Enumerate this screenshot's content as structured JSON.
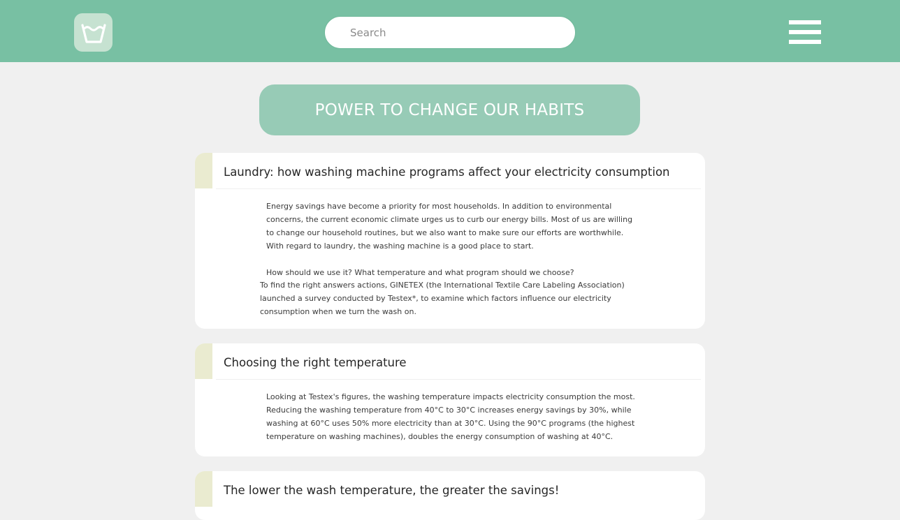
{
  "header": {
    "logo_icon": "wash-basin-icon",
    "search": {
      "placeholder": "Search",
      "value": ""
    },
    "menu_icon": "hamburger-menu-icon",
    "colors": {
      "header_bg": "#78c0a3",
      "banner_bg": "#97cbb6",
      "accent": "#eaebd0"
    }
  },
  "banner": {
    "title": "POWER TO CHANGE OUR HABITS"
  },
  "articles": [
    {
      "title": "Laundry: how washing machine programs affect your electricity consumption",
      "paragraphs": [
        "Energy savings have become a priority for most households. In addition to environmental concerns, the current economic climate urges us to curb our energy bills. Most of us are willing to change our household routines, but we also want to make sure our efforts are worthwhile. With regard to laundry, the washing machine is a good place to start.",
        "How should we use it? What temperature and what program should we choose?",
        "To find the right answers actions, GINETEX (the International Textile Care Labeling Association) launched a survey conducted by Testex*, to examine which factors influence our electricity consumption when we turn the wash on."
      ]
    },
    {
      "title": "Choosing the right temperature",
      "paragraphs": [
        "Looking at Testex's figures, the washing temperature impacts electricity consumption the most. Reducing the washing temperature from 40°C to 30°C increases energy savings by 30%, while washing at 60°C uses 50% more electricity than at 30°C. Using the 90°C programs (the highest temperature on washing machines), doubles the energy consumption of washing at 40°C."
      ]
    },
    {
      "title": "The lower the wash temperature, the greater the savings!"
    }
  ]
}
